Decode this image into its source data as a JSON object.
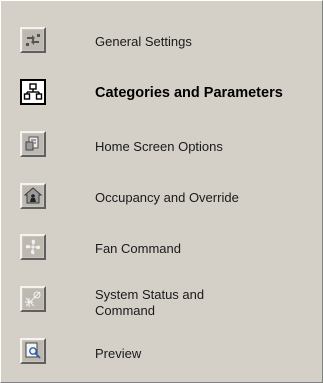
{
  "nav": {
    "items": [
      {
        "label": "General Settings",
        "icon": "general-settings-icon",
        "active": false
      },
      {
        "label": "Categories and Parameters",
        "icon": "categories-parameters-icon",
        "active": true
      },
      {
        "label": "Home Screen Options",
        "icon": "home-screen-options-icon",
        "active": false
      },
      {
        "label": "Occupancy and Override",
        "icon": "occupancy-override-icon",
        "active": false
      },
      {
        "label": "Fan Command",
        "icon": "fan-icon",
        "active": false
      },
      {
        "label": "System Status and Command",
        "icon": "system-status-icon",
        "active": false
      },
      {
        "label": "Preview",
        "icon": "preview-icon",
        "active": false
      }
    ]
  },
  "colors": {
    "background": "#d4d0c8",
    "icon_face": "#c8c4bc",
    "active_icon_face": "#ffffff",
    "text": "#1a1a1a",
    "accent_blue": "#2a5fb8"
  }
}
